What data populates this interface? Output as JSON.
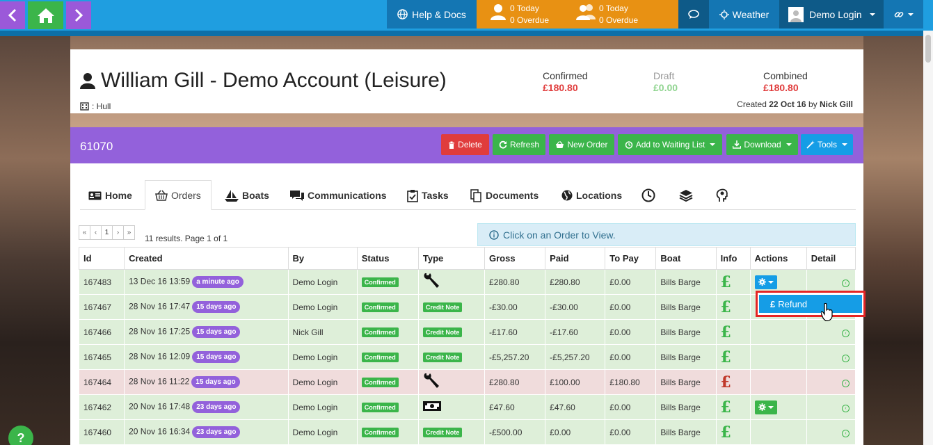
{
  "topbar": {
    "help_label": "Help & Docs",
    "tasks": [
      {
        "today": "0 Today",
        "overdue": "0 Overdue"
      },
      {
        "today": "0 Today",
        "overdue": "0 Overdue"
      }
    ],
    "weather_label": "Weather",
    "user_label": "Demo Login"
  },
  "account": {
    "name": "William Gill - Demo Account (Leisure)",
    "location": ": Hull",
    "confirmed_label": "Confirmed",
    "confirmed_value": "£180.80",
    "draft_label": "Draft",
    "draft_value": "£0.00",
    "combined_label": "Combined",
    "combined_value": "£180.80",
    "created_prefix": "Created",
    "created_date": "22 Oct 16",
    "created_by_prefix": "by",
    "created_by": "Nick Gill",
    "number": "61070"
  },
  "actions": {
    "delete": "Delete",
    "refresh": "Refresh",
    "new_order": "New Order",
    "waiting": "Add to Waiting List",
    "download": "Download",
    "tools": "Tools"
  },
  "tabs": [
    "Home",
    "Orders",
    "Boats",
    "Communications",
    "Tasks",
    "Documents",
    "Locations"
  ],
  "pager": {
    "first": "«",
    "prev": "‹",
    "page": "1",
    "next": "›",
    "last": "»",
    "results": "11 results. Page 1 of 1"
  },
  "info": "Click on an Order to View.",
  "table": {
    "headers": [
      "Id",
      "Created",
      "By",
      "Status",
      "Type",
      "Gross",
      "Paid",
      "To Pay",
      "Boat",
      "Info",
      "Actions",
      "Detail"
    ],
    "rows": [
      {
        "id": "167483",
        "created": "13 Dec 16 13:59",
        "ago": "a minute ago",
        "by": "Demo Login",
        "status": "Confirmed",
        "type": "wrench",
        "gross": "£280.80",
        "paid": "£280.80",
        "topay": "£0.00",
        "boat": "Bills Barge",
        "info": "£",
        "actions": "gear"
      },
      {
        "id": "167467",
        "created": "28 Nov 16 17:47",
        "ago": "15 days ago",
        "by": "Demo Login",
        "status": "Confirmed",
        "type": "Credit Note",
        "gross": "-£30.00",
        "paid": "-£30.00",
        "topay": "£0.00",
        "boat": "Bills Barge",
        "info": "£",
        "actions": ""
      },
      {
        "id": "167466",
        "created": "28 Nov 16 17:25",
        "ago": "15 days ago",
        "by": "Nick Gill",
        "status": "Confirmed",
        "type": "Credit Note",
        "gross": "-£17.60",
        "paid": "-£17.60",
        "topay": "£0.00",
        "boat": "Bills Barge",
        "info": "£",
        "actions": ""
      },
      {
        "id": "167465",
        "created": "28 Nov 16 12:09",
        "ago": "15 days ago",
        "by": "Demo Login",
        "status": "Confirmed",
        "type": "Credit Note",
        "gross": "-£5,257.20",
        "paid": "-£5,257.20",
        "topay": "£0.00",
        "boat": "Bills Barge",
        "info": "£",
        "actions": ""
      },
      {
        "id": "167464",
        "created": "28 Nov 16 11:22",
        "ago": "15 days ago",
        "by": "Demo Login",
        "status": "Confirmed",
        "type": "wrench",
        "gross": "£280.80",
        "paid": "£100.00",
        "topay": "£180.80",
        "boat": "Bills Barge",
        "info": "£",
        "actions": ""
      },
      {
        "id": "167462",
        "created": "20 Nov 16 17:48",
        "ago": "23 days ago",
        "by": "Demo Login",
        "status": "Confirmed",
        "type": "money",
        "gross": "£47.60",
        "paid": "£47.60",
        "topay": "£0.00",
        "boat": "Bills Barge",
        "info": "£",
        "actions": "gear"
      },
      {
        "id": "167460",
        "created": "20 Nov 16 16:34",
        "ago": "23 days ago",
        "by": "Demo Login",
        "status": "Confirmed",
        "type": "Credit Note",
        "gross": "-£500.00",
        "paid": "£0.00",
        "topay": "£0.00",
        "boat": "Bills Barge",
        "info": "£",
        "actions": ""
      }
    ]
  },
  "dropdown": {
    "refund": "Refund"
  },
  "help": "?"
}
